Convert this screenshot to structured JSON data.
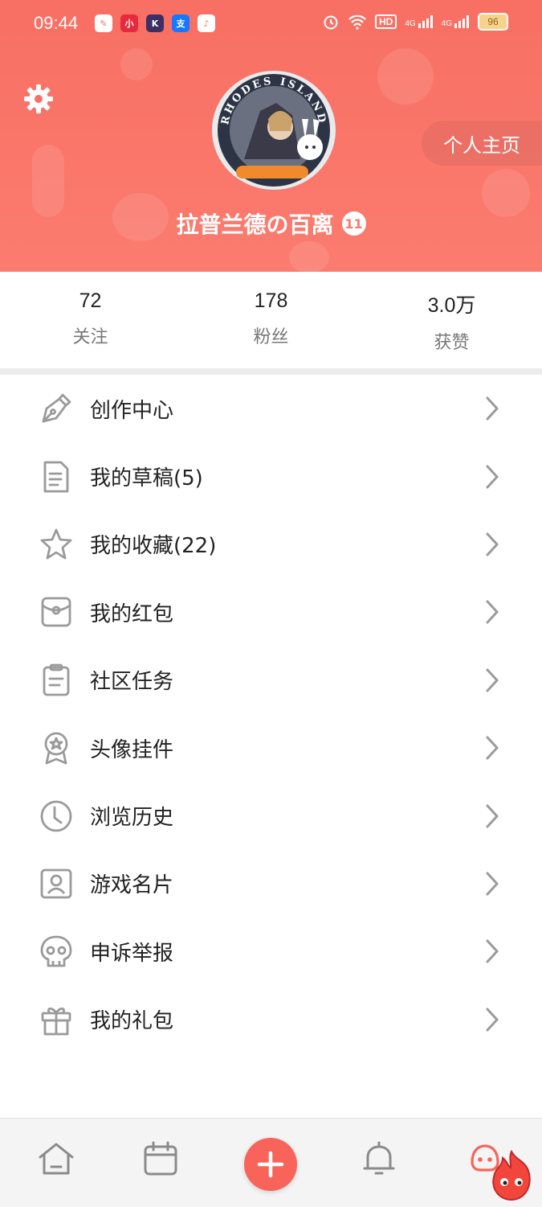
{
  "colors": {
    "header_bg": "#f86f63",
    "accent": "#f8645a",
    "text": "#222222",
    "muted": "#777777",
    "icon_gray": "#9a9a9a"
  },
  "status_bar": {
    "time": "09:44",
    "app_icons": [
      "notes-app-icon",
      "xiaohongshu-icon",
      "k-app-icon",
      "alipay-icon",
      "music-app-icon"
    ],
    "battery": "96",
    "signal_labels": [
      "4G",
      "4G"
    ],
    "hd_label": "HD"
  },
  "header": {
    "avatar_text": "RHODES ISLAND",
    "profile_button": "个人主页",
    "username": "拉普兰德の百离",
    "level": "11"
  },
  "stats": [
    {
      "value": "72",
      "label": "关注"
    },
    {
      "value": "178",
      "label": "粉丝"
    },
    {
      "value": "3.0万",
      "label": "获赞"
    }
  ],
  "menu": [
    {
      "label": "创作中心",
      "icon": "pen-nib-icon"
    },
    {
      "label": "我的草稿(5)",
      "icon": "document-icon"
    },
    {
      "label": "我的收藏(22)",
      "icon": "star-icon"
    },
    {
      "label": "我的红包",
      "icon": "red-packet-icon"
    },
    {
      "label": "社区任务",
      "icon": "clipboard-icon"
    },
    {
      "label": "头像挂件",
      "icon": "medal-icon"
    },
    {
      "label": "浏览历史",
      "icon": "clock-icon"
    },
    {
      "label": "游戏名片",
      "icon": "id-card-icon"
    },
    {
      "label": "申诉举报",
      "icon": "skull-icon"
    },
    {
      "label": "我的礼包",
      "icon": "gift-icon"
    }
  ],
  "bottom_nav": [
    {
      "name": "home",
      "icon": "home-icon"
    },
    {
      "name": "calendar",
      "icon": "calendar-icon"
    },
    {
      "name": "create",
      "icon": "plus-icon"
    },
    {
      "name": "notifications",
      "icon": "bell-icon"
    },
    {
      "name": "profile",
      "icon": "mascot-icon"
    }
  ]
}
